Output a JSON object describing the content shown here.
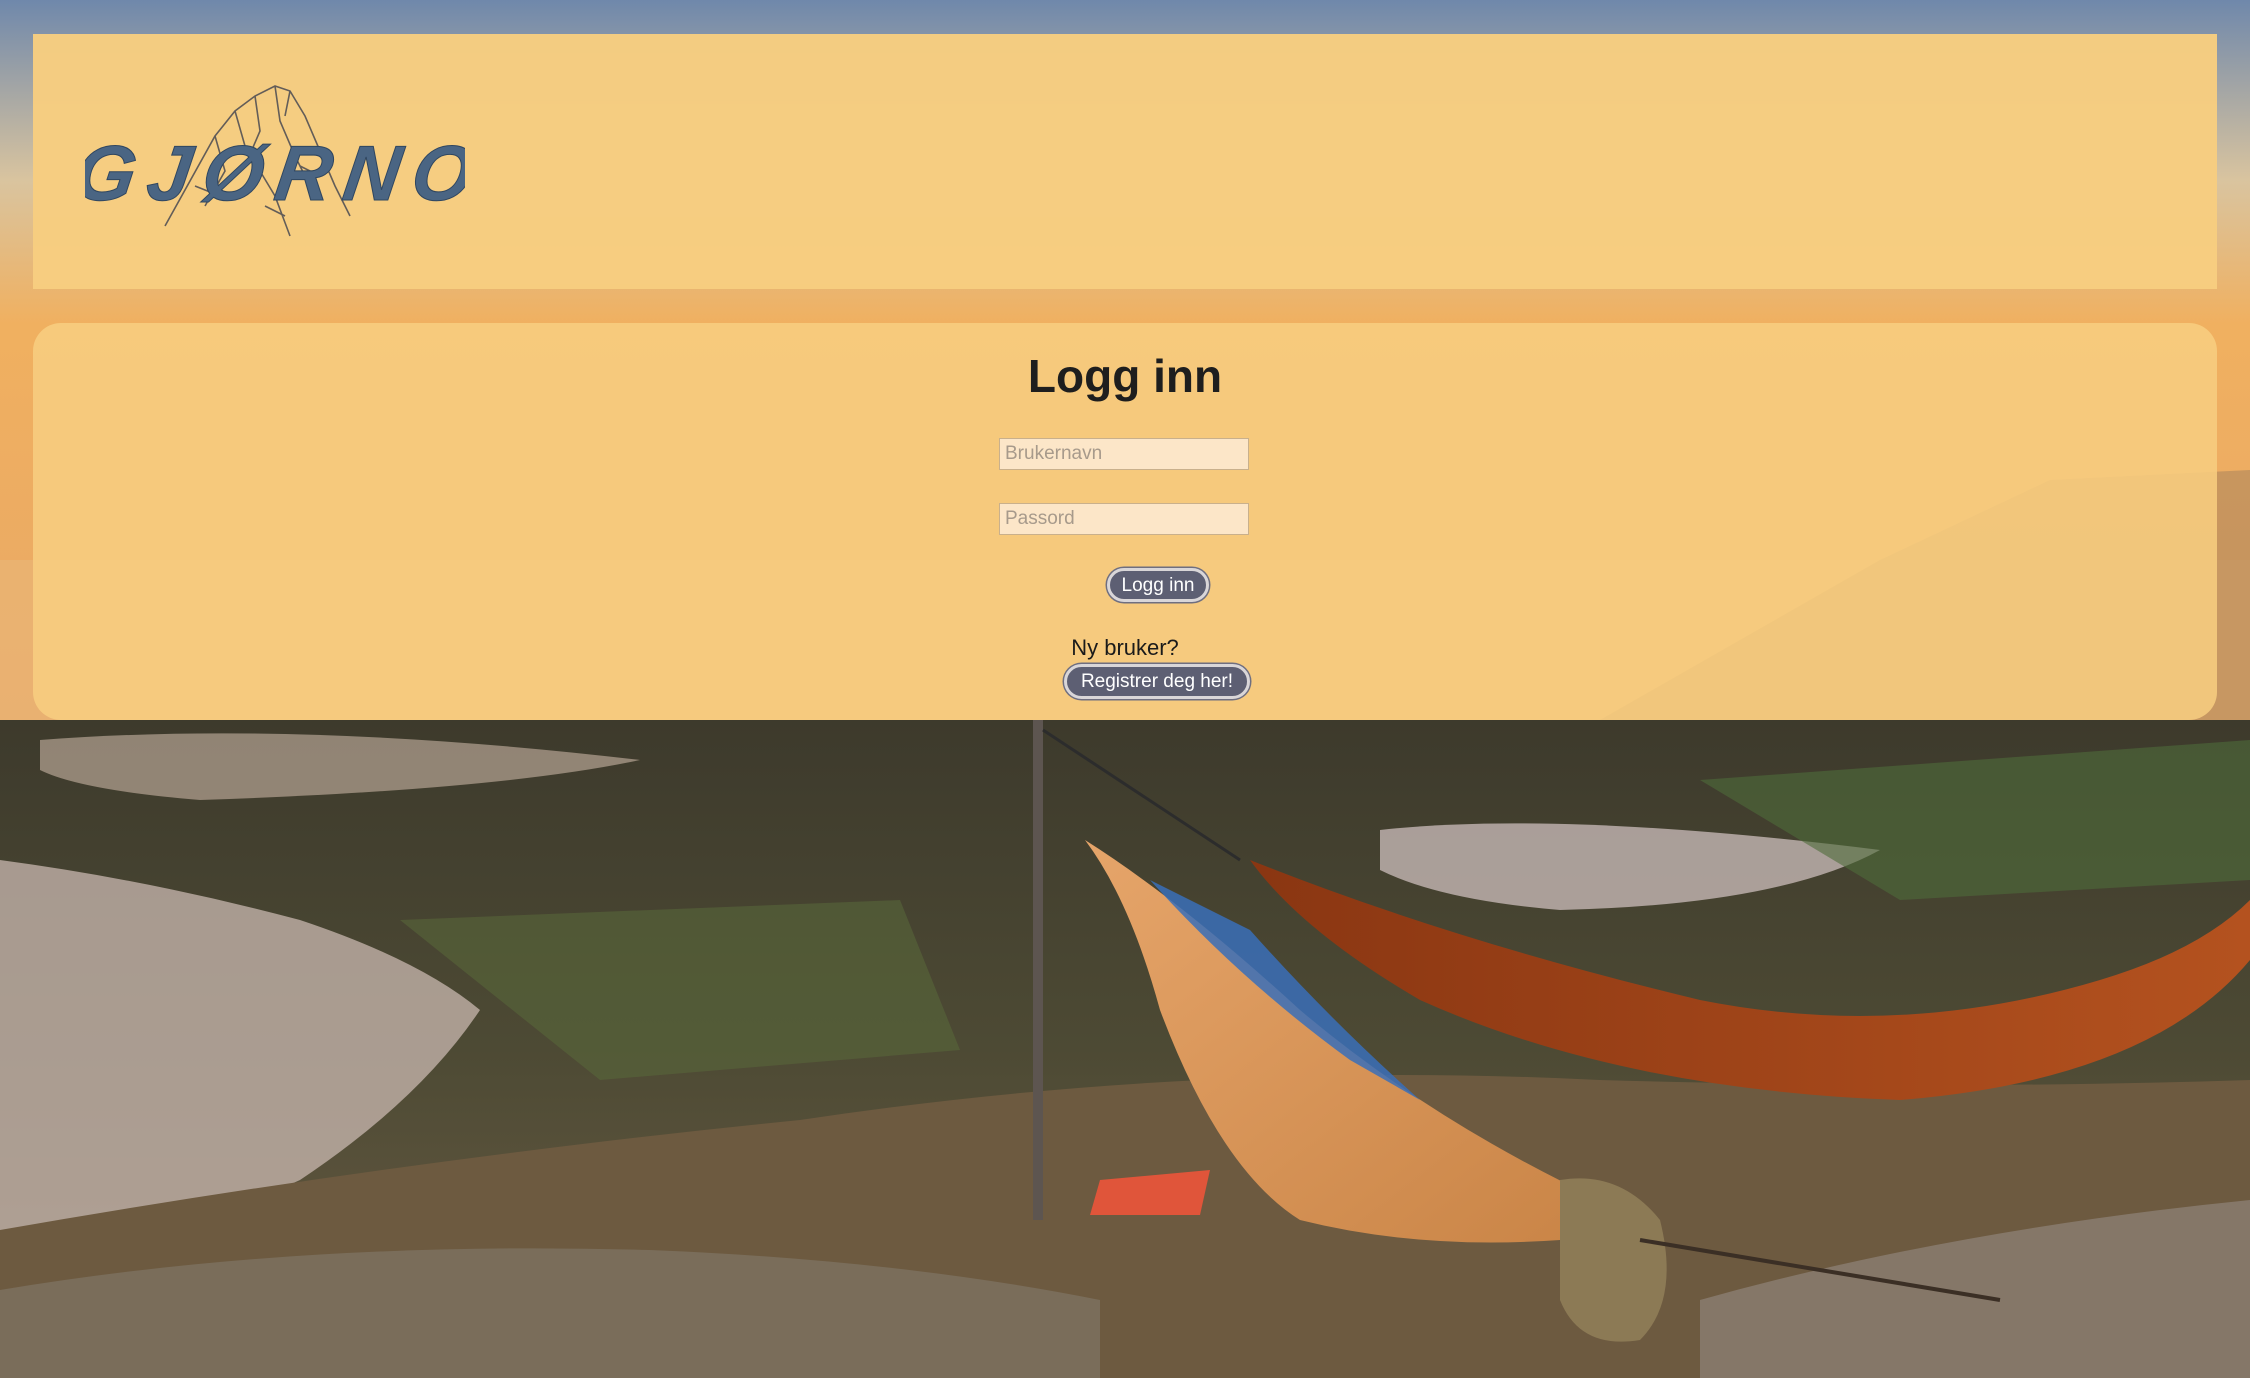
{
  "brand": {
    "logo_text": "GJØRNO'"
  },
  "login": {
    "title": "Logg inn",
    "username_placeholder": "Brukernavn",
    "password_placeholder": "Passord",
    "submit_label": "Logg inn",
    "new_user_text": "Ny bruker?",
    "register_label": "Registrer deg her!"
  },
  "colors": {
    "panel_background": "#f7cd80",
    "button_background": "#5d5f73",
    "logo_color": "#4a6583"
  },
  "icons": {
    "logo_mark": "mountain-sketch-icon"
  }
}
